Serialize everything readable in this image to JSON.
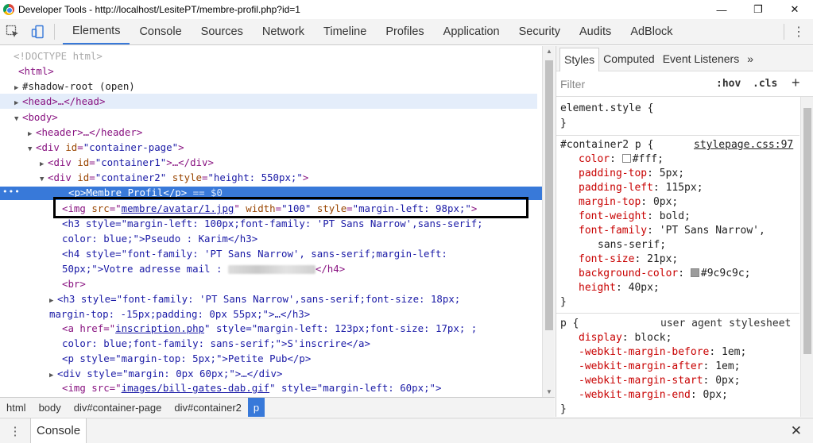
{
  "window": {
    "title": "Developer Tools - http://localhost/LesitePT/membre-profil.php?id=1",
    "minimize": "—",
    "maximize": "❐",
    "close": "✕"
  },
  "toolbar": {
    "tabs": [
      "Elements",
      "Console",
      "Sources",
      "Network",
      "Timeline",
      "Profiles",
      "Application",
      "Security",
      "Audits",
      "AdBlock"
    ],
    "active_tab": "Elements",
    "menu": "⋮"
  },
  "elements": {
    "doctype": "<!DOCTYPE html>",
    "html_open": "<html>",
    "shadow_root": "#shadow-root (open)",
    "head": "<head>…</head>",
    "body_open": "<body>",
    "header": "<header>…</header>",
    "container_page": {
      "tag": "<div ",
      "attr": "id",
      "val": "\"container-page\"",
      "end": ">"
    },
    "container1": {
      "tag": "<div ",
      "attr": "id",
      "val": "\"container1\"",
      "end": ">…</div>"
    },
    "container2": {
      "tag": "<div ",
      "attr": "id",
      "val": "\"container2\"",
      "attr2": " style",
      "val2": "\"height: 550px;\"",
      "end": ">"
    },
    "p_selected": {
      "text": "<p>Membre Profil</p>",
      "marker": "== $0",
      "dots": "•••"
    },
    "img": {
      "tag": "<img ",
      "attr": "src",
      "link": "membre/avatar/1.jpg",
      "attr2": " width",
      "val2": "\"100\"",
      "attr3": " style",
      "val3": "\"margin-left: 98px;\"",
      "end": ">"
    },
    "h3_line1": "<h3 style=\"margin-left: 100px;font-family: 'PT Sans Narrow',sans-serif;",
    "h3_line2": "color: blue;\">Pseudo : Karim</h3>",
    "h4_line1": "<h4 style=\"font-family: 'PT Sans Narrow', sans-serif;margin-left:",
    "h4_line2_pre": "50px;\">Votre adresse mail : ",
    "h4_line2_post": "</h4>",
    "br": "<br>",
    "h3b_line1": "<h3 style=\"font-family: 'PT Sans Narrow',sans-serif;font-size: 18px;",
    "h3b_line2": "margin-top: -15px;padding: 0px 55px;\">…</h3>",
    "a_line1_pre": "<a href=\"",
    "a_link": "inscription.php",
    "a_line1_post": "\" style=\"margin-left: 123px;font-size: 17px; ;",
    "a_line2": "color: blue;font-family: sans-serif;\">S'inscrire</a>",
    "p_pub": "<p style=\"margin-top: 5px;\">Petite Pub</p>",
    "div_margin": "<div style=\"margin: 0px 60px;\">…</div>",
    "img2_pre": "<img src=\"",
    "img2_link": "images/bill-gates-dab.gif",
    "img2_post": "\" style=\"margin-left: 60px;\">"
  },
  "breadcrumbs": [
    "html",
    "body",
    "div#container-page",
    "div#container2",
    "p"
  ],
  "sidebar": {
    "tabs": [
      "Styles",
      "Computed",
      "Event Listeners",
      "»"
    ],
    "active_tab": "Styles",
    "filter_placeholder": "Filter",
    "hov": ":hov",
    "cls": ".cls",
    "plus": "+",
    "element_style": "element.style {",
    "close_brace": "}",
    "rule1_selector": "#container2 p {",
    "rule1_source": "stylepage.css:97",
    "rule1_props": [
      {
        "name": "color",
        "value": "#fff;",
        "swatch": "#ffffff"
      },
      {
        "name": "padding-top",
        "value": "5px;"
      },
      {
        "name": "padding-left",
        "value": "115px;"
      },
      {
        "name": "margin-top",
        "value": "0px;"
      },
      {
        "name": "font-weight",
        "value": "bold;"
      },
      {
        "name": "font-family",
        "value": "'PT Sans Narrow',"
      },
      {
        "name": "",
        "value": "sans-serif;"
      },
      {
        "name": "font-size",
        "value": "21px;"
      },
      {
        "name": "background-color",
        "value": "#9c9c9c;",
        "swatch": "#9c9c9c"
      },
      {
        "name": "height",
        "value": "40px;"
      }
    ],
    "rule2_selector": "p {",
    "rule2_source": "user agent stylesheet",
    "rule2_props": [
      {
        "name": "display",
        "value": "block;"
      },
      {
        "name": "-webkit-margin-before",
        "value": "1em;"
      },
      {
        "name": "-webkit-margin-after",
        "value": "1em;"
      },
      {
        "name": "-webkit-margin-start",
        "value": "0px;"
      },
      {
        "name": "-webkit-margin-end",
        "value": "0px;"
      }
    ]
  },
  "drawer": {
    "menu": "⋮",
    "tab": "Console",
    "close": "✕"
  }
}
